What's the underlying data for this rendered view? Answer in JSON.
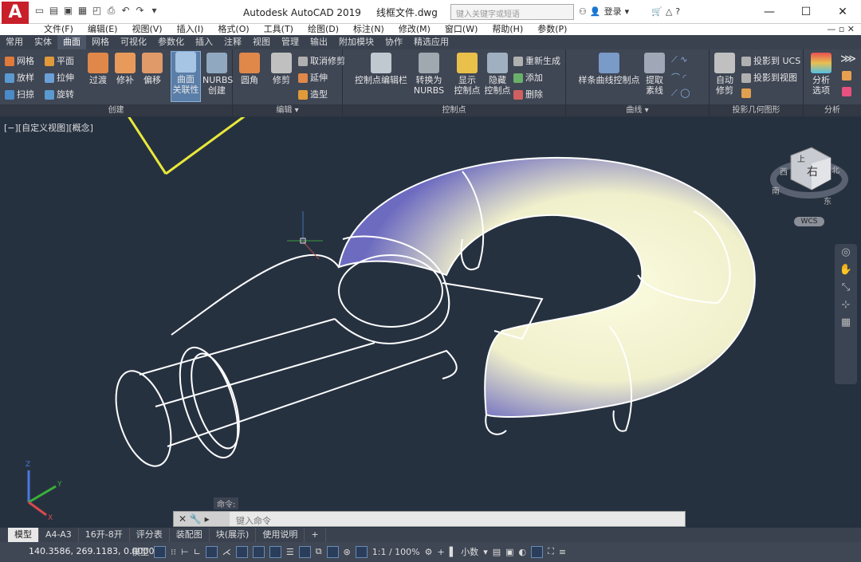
{
  "app": {
    "logo": "A",
    "title_app": "Autodesk AutoCAD 2019",
    "title_file": "线框文件.dwg",
    "search_placeholder": "键入关键字或短语",
    "login": "登录"
  },
  "menu": [
    "文件(F)",
    "编辑(E)",
    "视图(V)",
    "插入(I)",
    "格式(O)",
    "工具(T)",
    "绘图(D)",
    "标注(N)",
    "修改(M)",
    "窗口(W)",
    "帮助(H)",
    "参数(P)"
  ],
  "tabs": [
    "常用",
    "实体",
    "曲面",
    "网格",
    "可视化",
    "参数化",
    "插入",
    "注释",
    "视图",
    "管理",
    "输出",
    "附加模块",
    "协作",
    "精选应用"
  ],
  "active_tab": "曲面",
  "ribbon": {
    "create": {
      "label": "创建",
      "small": [
        "网格",
        "平面",
        "放样",
        "拉伸",
        "扫掠",
        "旋转"
      ],
      "big": [
        "过渡",
        "修补",
        "偏移",
        "曲面\n关联性",
        "NURBS\n创建"
      ]
    },
    "edit": {
      "label": "编辑",
      "big": [
        "圆角",
        "修剪"
      ],
      "small": [
        "取消修剪",
        "延伸",
        "造型"
      ]
    },
    "cp": {
      "label": "控制点",
      "big": [
        "控制点编辑栏",
        "转换为\nNURBS",
        "显示\n控制点",
        "隐藏\n控制点"
      ],
      "small": [
        "重新生成",
        "添加",
        "删除"
      ]
    },
    "curve": {
      "label": "曲线",
      "big": [
        "样条曲线控制点",
        "提取\n素线"
      ]
    },
    "proj": {
      "label": "投影几何图形",
      "big": [
        "自动\n修剪"
      ],
      "small": [
        "投影到 UCS",
        "投影到视图"
      ]
    },
    "analysis": {
      "label": "分析",
      "big": [
        "分析\n选项"
      ]
    }
  },
  "viewport": {
    "label": "[−][自定义视图][概念]",
    "viewcube_face": "右",
    "viewcube_top": "上",
    "wcs": "WCS",
    "compass": [
      "北",
      "东",
      "南",
      "西"
    ]
  },
  "command": {
    "label": "命令:",
    "placeholder": "键入命令"
  },
  "layout_tabs": [
    "模型",
    "A4-A3",
    "16开-8开",
    "评分表",
    "装配图",
    "块(展示)",
    "使用说明",
    "+"
  ],
  "status": {
    "coords": "140.3586, 269.1183, 0.0000",
    "model": "模型",
    "scale": "1:1 / 100%",
    "units": "小数"
  },
  "colors": {
    "logo": "#c8202a",
    "ribbon": "#3f4654",
    "viewport": "#263140",
    "arrow": "#e8e83a"
  }
}
